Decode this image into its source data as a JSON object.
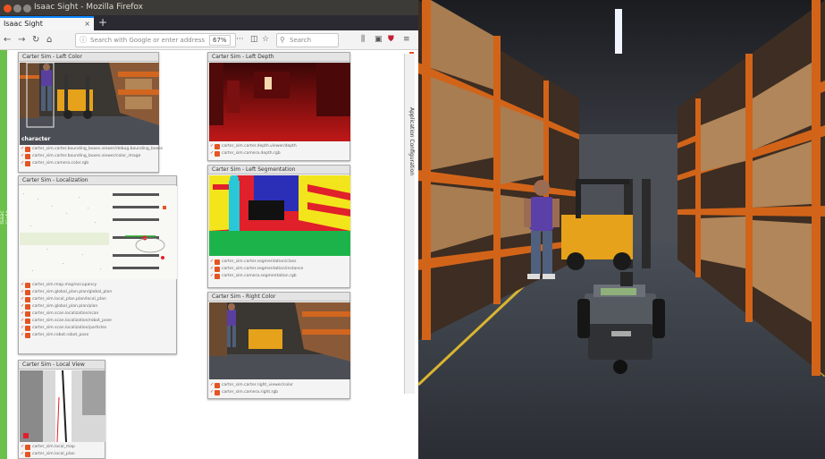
{
  "window": {
    "title": "Isaac Sight - Mozilla Firefox"
  },
  "browser": {
    "tab_label": "Isaac Sight",
    "new_tab": "+",
    "url_placeholder": "Search with Google or enter address",
    "zoom": "67%",
    "search_placeholder": "Search"
  },
  "sidebar": {
    "label": "Isaac Sight"
  },
  "app_config": {
    "label": "Application Configuration"
  },
  "panels": [
    {
      "title": "Carter Sim - Left Color",
      "overlay": "character",
      "rows": [
        "carter_sim.carter.bounding_boxes.viewer/debug.bounding_boxes",
        "carter_sim.carter.bounding_boxes.viewer/color_image",
        "carter_sim.camera.color.rgb"
      ]
    },
    {
      "title": "Carter Sim - Left Depth",
      "rows": [
        "carter_sim.carter.depth.viewer/depth",
        "carter_sim.camera.depth.rgb"
      ]
    },
    {
      "title": "Carter Sim - Localization",
      "rows": [
        "carter_sim.map.map/occupancy",
        "carter_sim.global_plan.plan/global_plan",
        "carter_sim.local_plan.plan/local_plan",
        "carter_sim.global_plan.plan/plan",
        "carter_sim.scan.localization/scan",
        "carter_sim.scan.localization/robot_pose",
        "carter_sim.scan.localization/particles",
        "carter_sim.robot.robot_pose"
      ]
    },
    {
      "title": "Carter Sim - Left Segmentation",
      "rows": [
        "carter_sim.carter.segmentation/class",
        "carter_sim.carter.segmentation/instance",
        "carter_sim.camera.segmentation.rgb"
      ]
    },
    {
      "title": "Carter Sim - Right Color",
      "rows": [
        "carter_sim.carter.right_viewer/color",
        "carter_sim.camera.right.rgb"
      ]
    },
    {
      "title": "Carter Sim - Local View",
      "rows": [
        "carter_sim.local_map",
        "carter_sim.local_plan"
      ]
    }
  ],
  "colors": {
    "ubuntu_close": "#e95420",
    "ubuntu_min": "#8a8782",
    "tab_accent": "#0a84ff",
    "sidebar_green": "#6bc04b",
    "row_icon": "#e35522",
    "seg_green": "#1cb44a",
    "seg_yellow": "#f3e51b",
    "seg_red": "#e0202a",
    "seg_blue": "#2b2fb8",
    "seg_cyan": "#28c8d8",
    "shelf_orange": "#e0661c"
  },
  "icons": {
    "back": "back-arrow-icon",
    "forward": "forward-arrow-icon",
    "reload": "reload-icon",
    "home": "home-icon",
    "info": "info-icon",
    "more": "more-icon",
    "pocket": "pocket-icon",
    "bookmark": "star-icon",
    "search": "search-icon",
    "library": "library-icon",
    "sidebar": "sidebar-icon",
    "shield": "shield-icon",
    "menu": "hamburger-menu-icon",
    "row_visibility": "visibility-check-icon"
  }
}
